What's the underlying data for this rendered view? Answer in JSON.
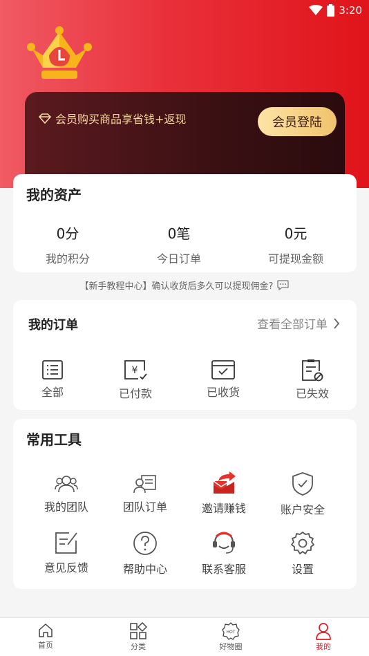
{
  "status_bar": {
    "time": "3:20"
  },
  "vip": {
    "promo_text": "会员购买商品享省钱+返现",
    "login_button": "会员登陆"
  },
  "assets": {
    "title": "我的资产",
    "items": [
      {
        "value": "0分",
        "label": "我的积分"
      },
      {
        "value": "0笔",
        "label": "今日订单"
      },
      {
        "value": "0元",
        "label": "可提现金额"
      }
    ]
  },
  "tip": {
    "text": "【新手教程中心】确认收货后多久可以提现佣金?"
  },
  "orders": {
    "title": "我的订单",
    "view_all": "查看全部订单",
    "items": [
      {
        "label": "全部",
        "icon": "list-icon"
      },
      {
        "label": "已付款",
        "icon": "paid-icon"
      },
      {
        "label": "已收货",
        "icon": "received-icon"
      },
      {
        "label": "已失效",
        "icon": "expired-icon"
      }
    ]
  },
  "tools": {
    "title": "常用工具",
    "items": [
      {
        "label": "我的团队",
        "icon": "team-icon"
      },
      {
        "label": "团队订单",
        "icon": "team-order-icon"
      },
      {
        "label": "邀请赚钱",
        "icon": "invite-icon"
      },
      {
        "label": "账户安全",
        "icon": "shield-icon"
      },
      {
        "label": "意见反馈",
        "icon": "feedback-icon"
      },
      {
        "label": "帮助中心",
        "icon": "help-icon"
      },
      {
        "label": "联系客服",
        "icon": "service-icon"
      },
      {
        "label": "设置",
        "icon": "gear-icon"
      }
    ]
  },
  "tabbar": {
    "items": [
      {
        "label": "首页",
        "icon": "home-icon"
      },
      {
        "label": "分类",
        "icon": "category-icon"
      },
      {
        "label": "好物圈",
        "icon": "hot-icon",
        "icon_text": "HOT"
      },
      {
        "label": "我的",
        "icon": "user-icon",
        "active": true
      }
    ]
  },
  "colors": {
    "accent": "#e01c24",
    "gold": "#f1c36b"
  }
}
